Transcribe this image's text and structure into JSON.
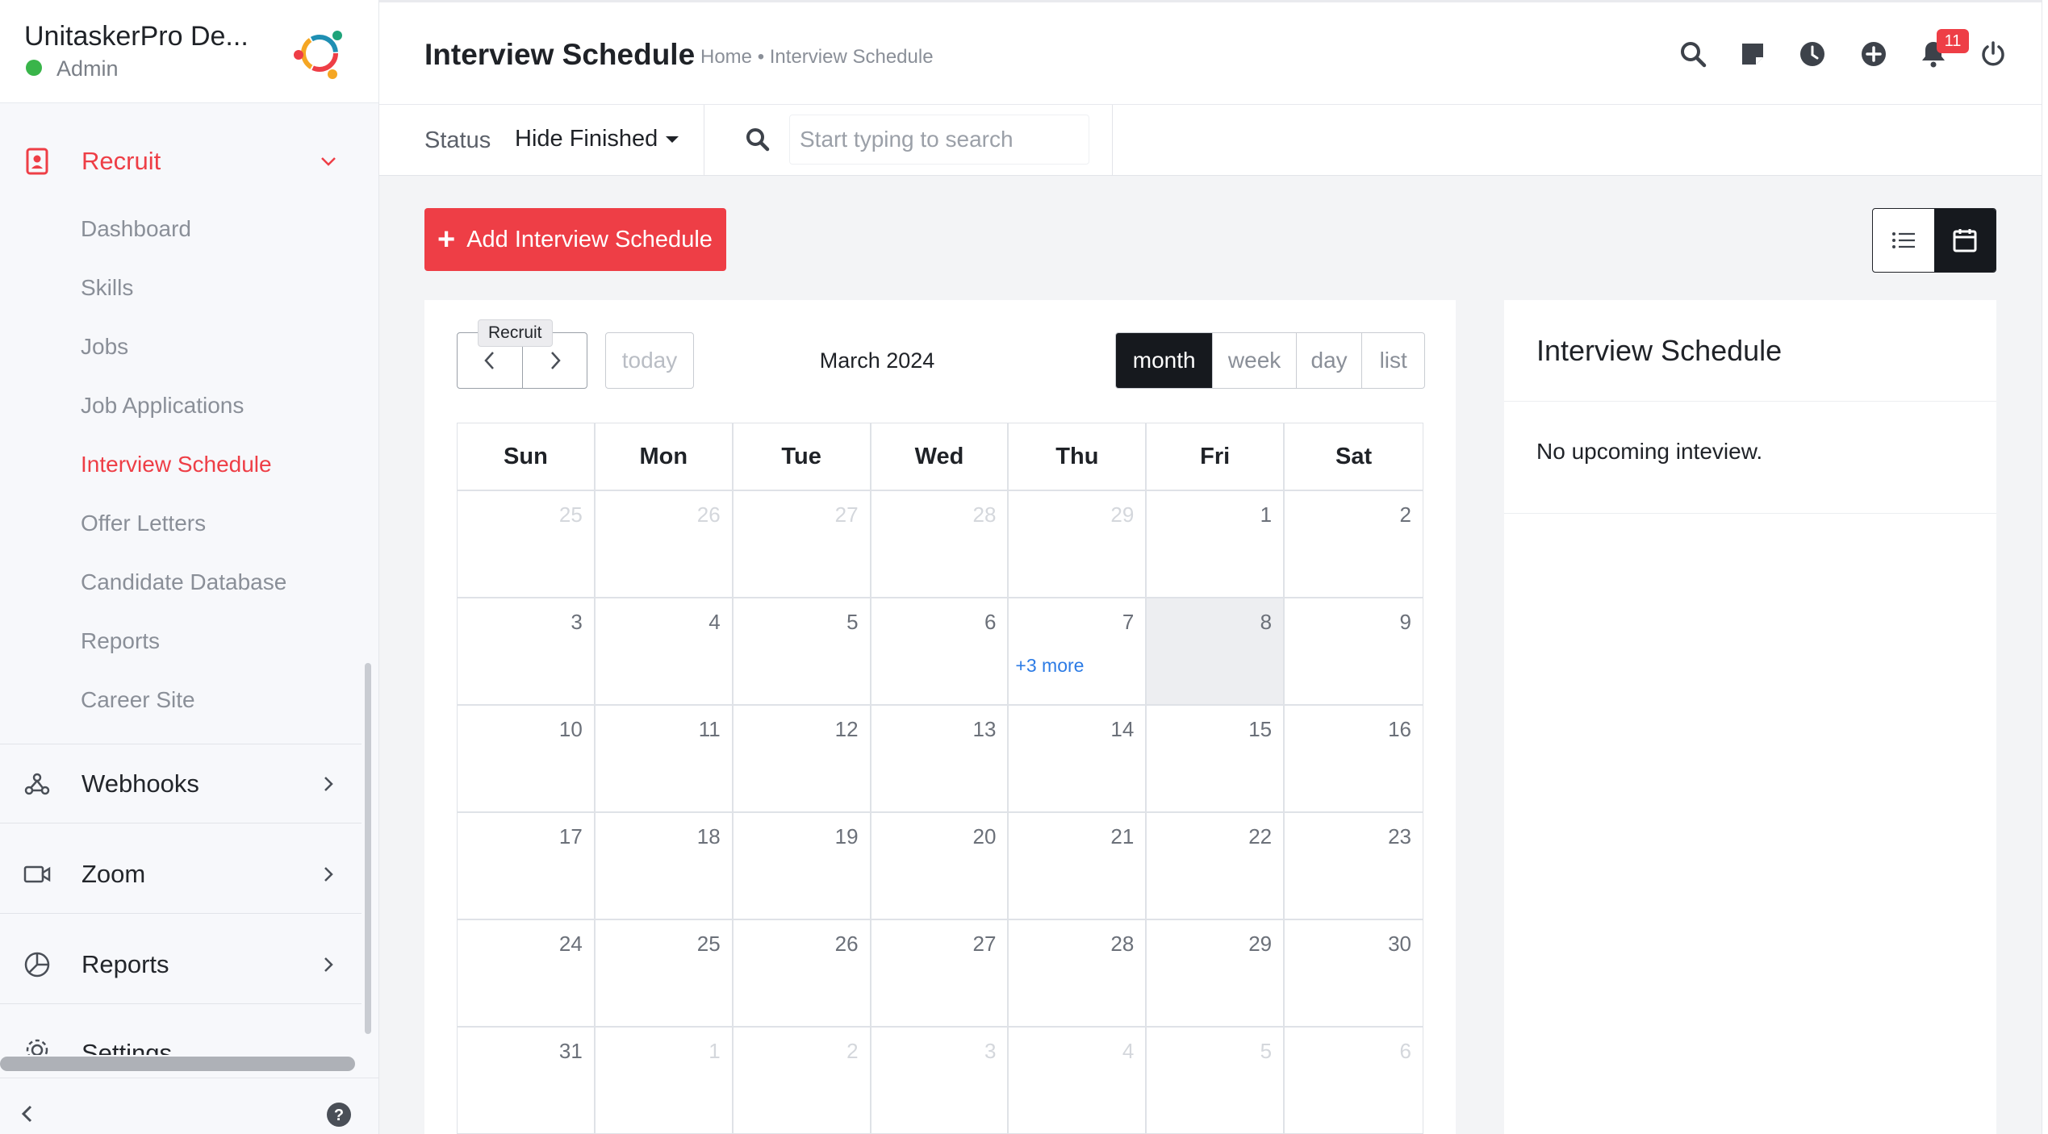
{
  "sidebar": {
    "company": "UnitaskerPro De...",
    "role": "Admin",
    "sections": [
      {
        "label": "Recruit",
        "icon": "recruit-icon",
        "expanded": true
      },
      {
        "label": "Webhooks",
        "icon": "webhook-icon"
      },
      {
        "label": "Zoom",
        "icon": "video-camera-icon"
      },
      {
        "label": "Reports",
        "icon": "pie-chart-icon"
      },
      {
        "label": "Settings",
        "icon": "gear-icon"
      }
    ],
    "recruit_items": [
      {
        "label": "Dashboard"
      },
      {
        "label": "Skills"
      },
      {
        "label": "Jobs"
      },
      {
        "label": "Job Applications"
      },
      {
        "label": "Interview Schedule",
        "active": true
      },
      {
        "label": "Offer Letters"
      },
      {
        "label": "Candidate Database"
      },
      {
        "label": "Reports"
      },
      {
        "label": "Career Site"
      }
    ]
  },
  "header": {
    "title": "Interview Schedule",
    "breadcrumb": "Home • Interview Schedule",
    "icons": [
      "search-icon",
      "sticky-note-icon",
      "clock-icon",
      "plus-circle-icon",
      "bell-icon",
      "power-icon"
    ],
    "notification_count": "11"
  },
  "filters": {
    "status_label": "Status",
    "status_value": "Hide Finished",
    "search_placeholder": "Start typing to search"
  },
  "actions": {
    "add_label": "Add Interview Schedule",
    "view_modes": [
      "list-icon",
      "calendar-icon"
    ],
    "active_view": "calendar"
  },
  "calendar": {
    "tooltip": "Recruit",
    "today_label": "today",
    "title": "March 2024",
    "ranges": [
      "month",
      "week",
      "day",
      "list"
    ],
    "active_range": "month",
    "weekdays": [
      "Sun",
      "Mon",
      "Tue",
      "Wed",
      "Thu",
      "Fri",
      "Sat"
    ],
    "weeks": [
      [
        {
          "d": "25",
          "o": true
        },
        {
          "d": "26",
          "o": true
        },
        {
          "d": "27",
          "o": true
        },
        {
          "d": "28",
          "o": true
        },
        {
          "d": "29",
          "o": true
        },
        {
          "d": "1"
        },
        {
          "d": "2"
        }
      ],
      [
        {
          "d": "3"
        },
        {
          "d": "4"
        },
        {
          "d": "5"
        },
        {
          "d": "6"
        },
        {
          "d": "7",
          "more": "+3 more"
        },
        {
          "d": "8",
          "today": true
        },
        {
          "d": "9"
        }
      ],
      [
        {
          "d": "10"
        },
        {
          "d": "11"
        },
        {
          "d": "12"
        },
        {
          "d": "13"
        },
        {
          "d": "14"
        },
        {
          "d": "15"
        },
        {
          "d": "16"
        }
      ],
      [
        {
          "d": "17"
        },
        {
          "d": "18"
        },
        {
          "d": "19"
        },
        {
          "d": "20"
        },
        {
          "d": "21"
        },
        {
          "d": "22"
        },
        {
          "d": "23"
        }
      ],
      [
        {
          "d": "24"
        },
        {
          "d": "25"
        },
        {
          "d": "26"
        },
        {
          "d": "27"
        },
        {
          "d": "28"
        },
        {
          "d": "29"
        },
        {
          "d": "30"
        }
      ],
      [
        {
          "d": "31"
        },
        {
          "d": "1",
          "o": true
        },
        {
          "d": "2",
          "o": true
        },
        {
          "d": "3",
          "o": true
        },
        {
          "d": "4",
          "o": true
        },
        {
          "d": "5",
          "o": true
        },
        {
          "d": "6",
          "o": true
        }
      ]
    ]
  },
  "upcoming": {
    "title": "Interview Schedule",
    "empty_text": "No upcoming inteview."
  },
  "colors": {
    "accent": "#ee3e46",
    "dark": "#16191e",
    "online": "#39b54a",
    "link": "#2c7be5"
  }
}
